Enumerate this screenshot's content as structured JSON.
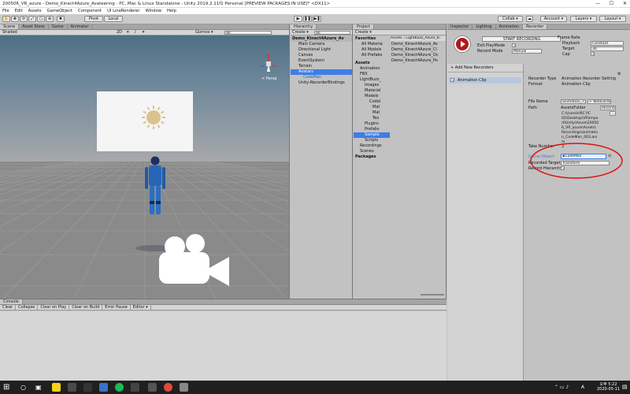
{
  "window": {
    "title": "200506_VR_azure - Demo_Kinect4Azure_Avateering - PC, Mac & Linux Standalone - Unity 2019.2.11f1 Personal [PREVIEW PACKAGES IN USE]* <DX11>",
    "min": "—",
    "max": "☐",
    "close": "✕"
  },
  "menu": [
    "File",
    "Edit",
    "Assets",
    "GameObject",
    "Component",
    "UI LineRenderer",
    "Window",
    "Help"
  ],
  "toolbar": {
    "pivot": "Pivot",
    "local": "Local",
    "collab": "Collab ▾",
    "account": "Account ▾",
    "layers": "Layers ▾",
    "layout": "Layout ▾"
  },
  "scene": {
    "tabs": [
      "Scene",
      "Asset Store",
      "Game",
      "Animator"
    ],
    "shading": "Shaded",
    "mode": "2D",
    "gizmos": "Gizmos ▾",
    "search": "All",
    "persp": "< Persp"
  },
  "hierarchy": {
    "tab": "Hierarchy",
    "create": "Create ▾",
    "search": "All",
    "items": [
      "Demo_Kinect4Azure_Av",
      "Main Camera",
      "Directional Light",
      "Canvas",
      "EventSystem",
      "Terrain",
      "Avatars",
      "CodeMan",
      "Unity-RecorderBindings"
    ]
  },
  "project": {
    "tab": "Project",
    "create": "Create ▾",
    "favorites": "Favorites",
    "fav_items": [
      "All Materia",
      "All Models",
      "All Prefabs"
    ],
    "assets": "Assets",
    "asset_items": [
      "Animation",
      "FBX",
      "LightBuzz_",
      "Images",
      "Material",
      "Models",
      "Codel",
      "Mat",
      "Mat",
      "Tex",
      "Plugins",
      "Prefabs",
      "Sample",
      "Scripts",
      "Recordings",
      "Scenes"
    ],
    "packages": "Packages",
    "path": "Assets › LightBuzz_Azure_Ki",
    "files": [
      "Demo_Kinect4Azure_Av",
      "Demo_Kinect4Azure_Cl",
      "Demo_Kinect4Azure_Oc",
      "Demo_Kinect4Azure_Po"
    ]
  },
  "recorder": {
    "tabs": [
      "Inspector",
      "Lighting",
      "Animation",
      "Recorder"
    ],
    "start": "START RECORDING",
    "exit_label": "Exit PlayMode",
    "mode_label": "Record Mode",
    "mode_val": "Manual",
    "frame_rate": "Frame Rate",
    "playback_label": "Playback",
    "playback_val": "Constant",
    "target_label": "Target",
    "target_val": "30",
    "cap_label": "Cap",
    "add": "+ Add New Recorders",
    "clip": "Animation Clip",
    "type_label": "Recorder Type",
    "type_val": "Animation Recorder Setting",
    "format_label": "Format",
    "format_val": "Animation Clip",
    "file_label": "File Name",
    "file_val": "animation_<",
    "wildcards": "+ Wildcards ▾",
    "path_label": "Path",
    "path_root": "AssetsFolder",
    "path_rec": "Recordi",
    "path_text": [
      "C:\\Users\\HRC PC",
      "02\\Desktop\\VR\\Impo",
      "rt\\Unity\\Azure\\20050",
      "6_VR_azure\\Assets\\",
      "Recordings\\animatio",
      "n_CodeMan_003.ani",
      "m"
    ],
    "take_label": "Take Number",
    "take_val": "3",
    "go_label": "Game Object",
    "go_val": "CodeMan",
    "comp_label": "Recorded Target",
    "comp_val": "Transform",
    "hier_label": "Record Hierarchy"
  },
  "console": {
    "tab": "Console",
    "buttons": [
      "Clear",
      "Collapse",
      "Clear on Play",
      "Clear on Build",
      "Error Pause",
      "Editor ▾"
    ],
    "counts": [
      "0",
      "0",
      "0"
    ]
  },
  "taskbar": {
    "time": "오후 5:22",
    "date": "2020-05-11",
    "lang": "A"
  },
  "colors": {
    "selection": "#3e7de7",
    "annotation": "#e01010",
    "record": "#b0181c"
  }
}
